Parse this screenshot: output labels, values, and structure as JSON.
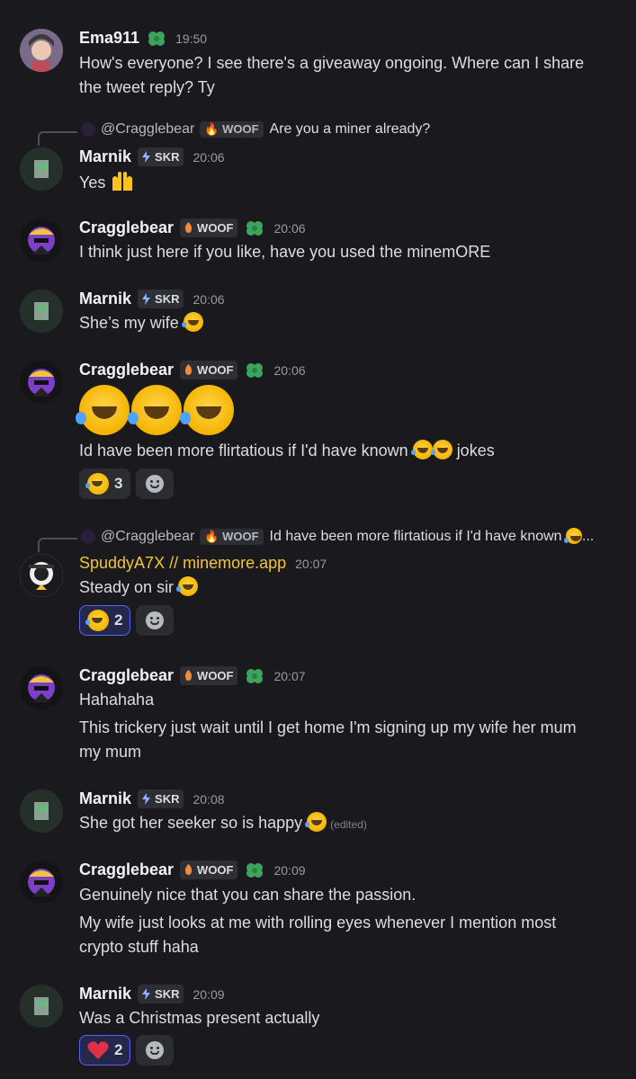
{
  "messages": [
    {
      "user": "Ema911",
      "time": "19:50",
      "lines": [
        "How's everyone? I see there's a giveaway ongoing. Where can I share",
        "the tweet reply? Ty"
      ]
    },
    {
      "reply": {
        "user": "@Cragglebear",
        "tag": "WOOF",
        "text": "Are you a miner already?"
      },
      "user": "Marnik",
      "tag": "SKR",
      "time": "20:06",
      "text": "Yes"
    },
    {
      "user": "Cragglebear",
      "tag": "WOOF",
      "time": "20:06",
      "text": "I think just here if you like, have you used the minemORE"
    },
    {
      "user": "Marnik",
      "tag": "SKR",
      "time": "20:06",
      "text": "She’s my wife"
    },
    {
      "user": "Cragglebear",
      "tag": "WOOF",
      "time": "20:06",
      "text": "Id have been more flirtatious if I'd have known",
      "text_suffix": "jokes",
      "reaction_count": "3"
    },
    {
      "reply": {
        "user": "@Cragglebear",
        "tag": "WOOF",
        "text": "Id have been more flirtatious if I'd have known",
        "ellipsis": "..."
      },
      "user": "SpuddyA7X // minemore.app",
      "time": "20:07",
      "text": "Steady on sir",
      "reaction_count": "2"
    },
    {
      "user": "Cragglebear",
      "tag": "WOOF",
      "time": "20:07",
      "lines": [
        "Hahahaha",
        "This trickery just wait until I get home I'm signing up my wife her mum",
        "my mum"
      ]
    },
    {
      "user": "Marnik",
      "tag": "SKR",
      "time": "20:08",
      "text": "She got her seeker so is happy",
      "edited": "(edited)"
    },
    {
      "user": "Cragglebear",
      "tag": "WOOF",
      "time": "20:09",
      "lines": [
        "Genuinely nice that you can share the passion.",
        "My wife just looks at me with rolling eyes whenever I mention most",
        "crypto stuff haha"
      ]
    },
    {
      "user": "Marnik",
      "tag": "SKR",
      "time": "20:09",
      "text": "Was a Christmas present actually",
      "reaction_count": "2"
    }
  ],
  "icons": {
    "woof": "dog-icon",
    "skr": "lightning-icon",
    "clover": "clover-icon",
    "laugh": "rofl-emoji",
    "joy": "joy-emoji",
    "heart": "heart-emoji",
    "add_reaction": "add-reaction-icon"
  },
  "colors": {
    "background": "#1a1a1e",
    "accent": "#5865f2",
    "gold_name": "#f0c537"
  }
}
